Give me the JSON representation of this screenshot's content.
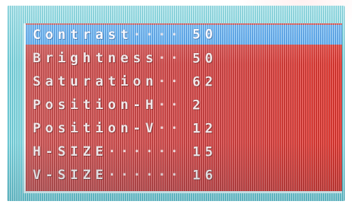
{
  "osd_menu": {
    "items": [
      {
        "label": "Contrast",
        "dots": "····",
        "value": "50",
        "selected": true
      },
      {
        "label": "Brightness",
        "dots": "··",
        "value": "50",
        "selected": false
      },
      {
        "label": "Saturation",
        "dots": "··",
        "value": "62",
        "selected": false
      },
      {
        "label": "Position-H",
        "dots": "··",
        "value": "2",
        "selected": false
      },
      {
        "label": "Position-V",
        "dots": "··",
        "value": "12",
        "selected": false
      },
      {
        "label": "H-SIZE",
        "dots": "······",
        "value": "15",
        "selected": false
      },
      {
        "label": "V-SIZE",
        "dots": "······",
        "value": "16",
        "selected": false
      }
    ]
  },
  "colors": {
    "frame": "#7ad3dc",
    "panel": "#cf4a4a",
    "selection": "#52a8ee",
    "text": "#f3e8ea"
  }
}
